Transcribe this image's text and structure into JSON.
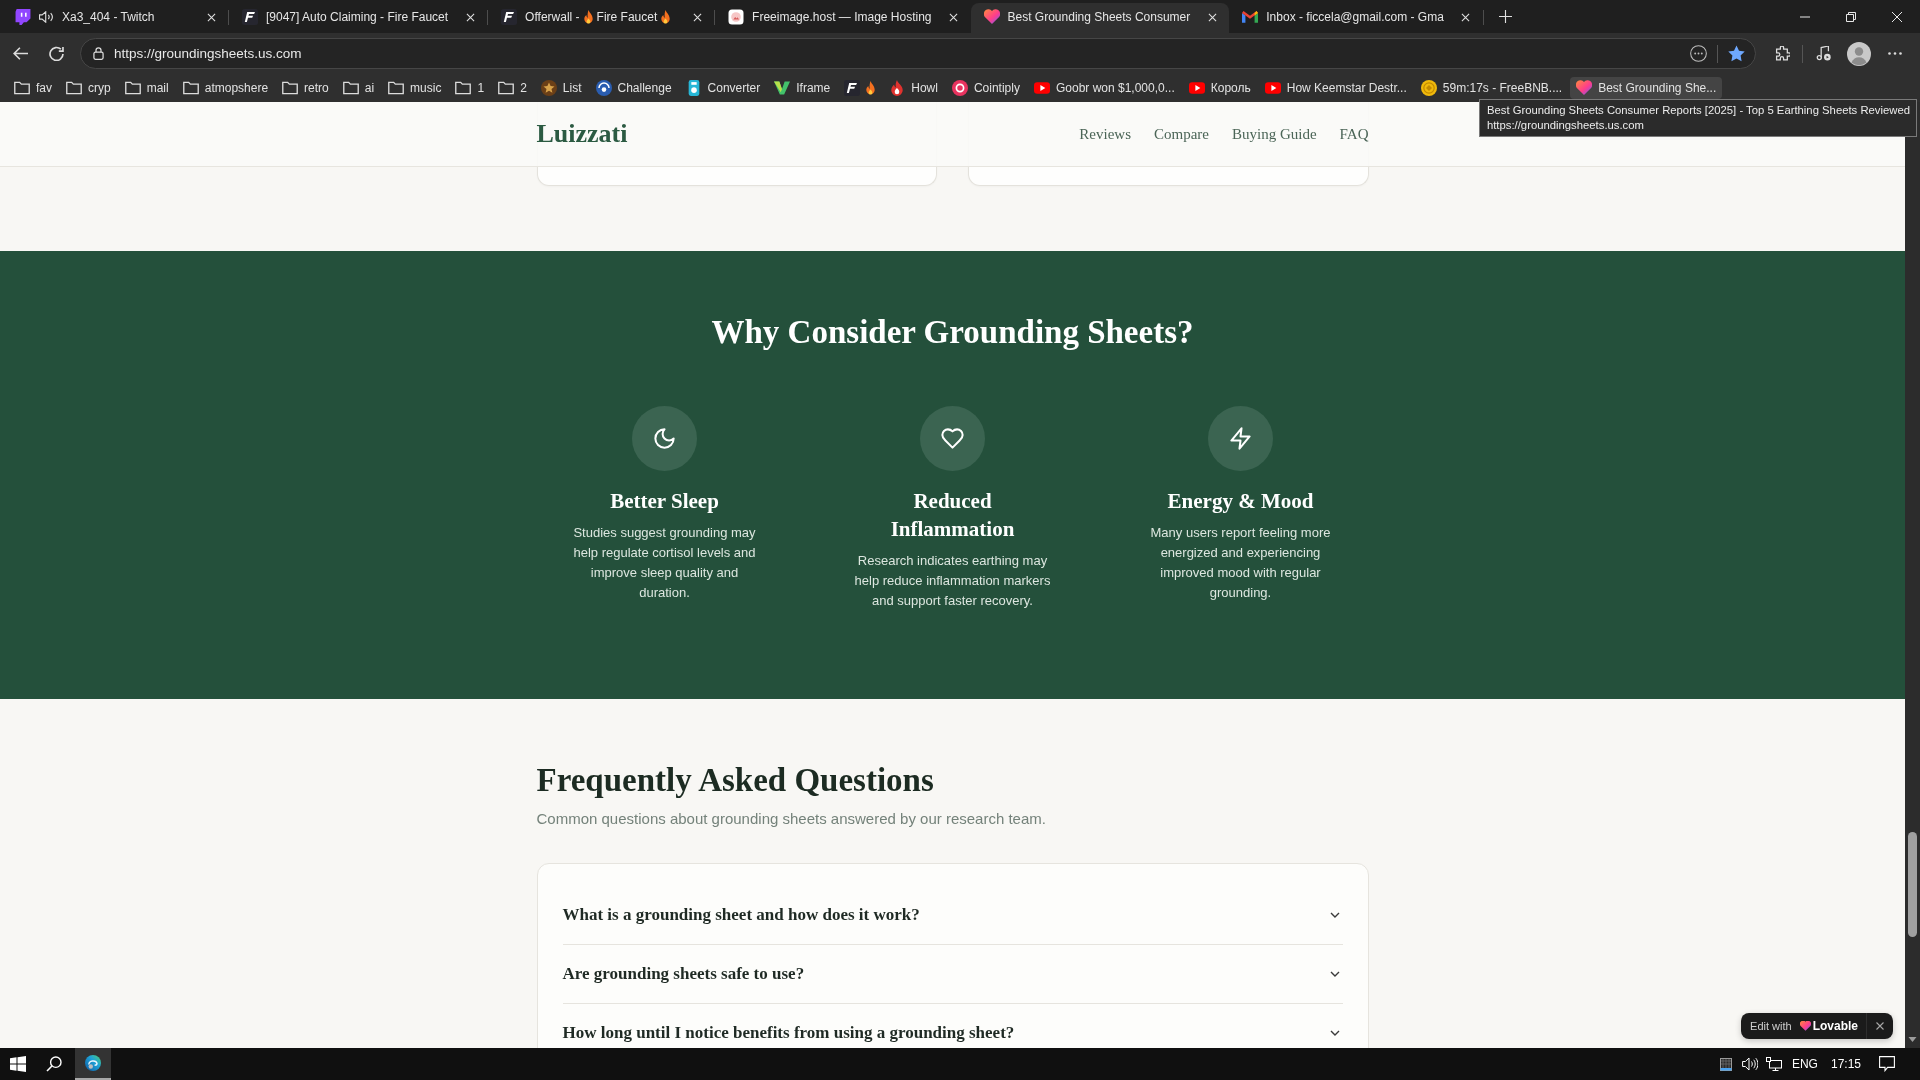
{
  "browser": {
    "tabs": [
      {
        "kind": "chat",
        "title": "Xa3_404 - Twitch",
        "audio": true,
        "selected": false
      },
      {
        "kind": "letter",
        "title": "[9047] Auto Claiming - Fire Faucet",
        "audio": false,
        "selected": false
      },
      {
        "kind": "letter",
        "title": [
          {
            "kind": "text",
            "text": "Offerwall -"
          },
          {
            "kind": "flame"
          },
          {
            "kind": "text",
            "text": "Fire Faucet"
          },
          {
            "kind": "flame"
          }
        ],
        "audio": false,
        "selected": false
      },
      {
        "kind": "photo",
        "title": "Freeimage.host — Image Hosting",
        "audio": false,
        "selected": false
      },
      {
        "kind": "heart",
        "title": "Best Grounding Sheets Consumer",
        "audio": false,
        "selected": true
      },
      {
        "kind": "mail",
        "title": "Inbox - ficcela@gmail.com - Gma",
        "audio": false,
        "selected": false
      }
    ],
    "address_bar": {
      "url": "https://groundingsheets.us.com",
      "bookmarked": true
    },
    "bookmarks": [
      {
        "kind": "folder",
        "label": "fav",
        "hovered": false
      },
      {
        "kind": "folder",
        "label": "cryp",
        "hovered": false
      },
      {
        "kind": "folder",
        "label": "mail",
        "hovered": false
      },
      {
        "kind": "folder",
        "label": "atmopshere",
        "hovered": false
      },
      {
        "kind": "folder",
        "label": "retro",
        "hovered": false
      },
      {
        "kind": "folder",
        "label": "ai",
        "hovered": false
      },
      {
        "kind": "folder",
        "label": "music",
        "hovered": false
      },
      {
        "kind": "folder",
        "label": "1",
        "hovered": false
      },
      {
        "kind": "folder",
        "label": "2",
        "hovered": false
      },
      {
        "kind": "star",
        "label": "List",
        "hovered": false
      },
      {
        "kind": "globe",
        "label": "Challenge",
        "hovered": false
      },
      {
        "kind": "device",
        "label": "Converter",
        "hovered": false
      },
      {
        "kind": "vee",
        "label": "Iframe",
        "hovered": false
      },
      {
        "kind": "letter",
        "label": [
          {
            "kind": "flame"
          }
        ],
        "hovered": false
      },
      {
        "kind": "torch",
        "label": "Howl",
        "hovered": false
      },
      {
        "kind": "token",
        "label": "Cointiply",
        "hovered": false
      },
      {
        "kind": "play",
        "label": "Goobr won $1,000,0...",
        "hovered": false
      },
      {
        "kind": "play",
        "label": "Король",
        "hovered": false
      },
      {
        "kind": "play",
        "label": "How Keemstar Destr...",
        "hovered": false
      },
      {
        "kind": "coin",
        "label": "59m:17s - FreeBNB....",
        "hovered": false
      },
      {
        "kind": "heart",
        "label": "Best Grounding She...",
        "hovered": true
      }
    ],
    "tooltip": {
      "title": "Best Grounding Sheets Consumer Reports [2025] - Top 5 Earthing Sheets Reviewed",
      "url": "https://groundingsheets.us.com"
    }
  },
  "page": {
    "header": {
      "logo": "Luizzati",
      "nav": [
        "Reviews",
        "Compare",
        "Buying Guide",
        "FAQ"
      ]
    },
    "benefits": {
      "title": "Why Consider Grounding Sheets?",
      "items": [
        {
          "kind": "moon",
          "title": "Better Sleep",
          "text": "Studies suggest grounding may help regulate cortisol levels and improve sleep quality and duration."
        },
        {
          "kind": "heart",
          "title": "Reduced Inflammation",
          "text": "Research indicates earthing may help reduce inflammation markers and support faster recovery."
        },
        {
          "kind": "bolt",
          "title": "Energy & Mood",
          "text": "Many users report feeling more energized and experiencing improved mood with regular grounding."
        }
      ]
    },
    "faq": {
      "title": "Frequently Asked Questions",
      "subtitle": "Common questions about grounding sheets answered by our research team.",
      "items": [
        {
          "question": "What is a grounding sheet and how does it work?",
          "expanded": false
        },
        {
          "question": "Are grounding sheets safe to use?",
          "expanded": false
        },
        {
          "question": "How long until I notice benefits from using a grounding sheet?",
          "expanded": false
        }
      ]
    },
    "edit_badge": {
      "label": "Edit with",
      "brand": "Lovable"
    }
  },
  "taskbar": {
    "language": "ENG",
    "time": "17:15"
  }
}
